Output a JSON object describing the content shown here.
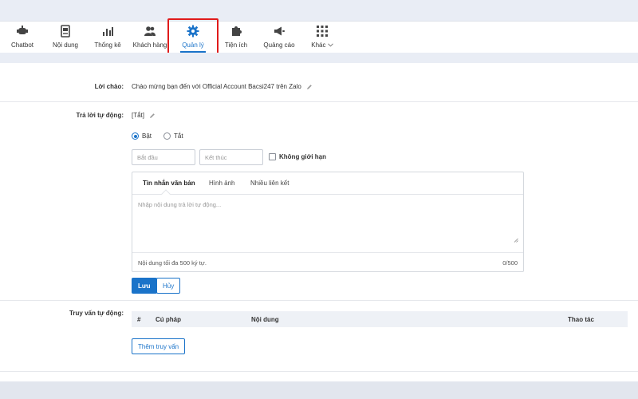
{
  "nav": {
    "items": [
      {
        "label": "Chatbot"
      },
      {
        "label": "Nội dung"
      },
      {
        "label": "Thống kê"
      },
      {
        "label": "Khách hàng"
      },
      {
        "label": "Quản lý"
      },
      {
        "label": "Tiện ích"
      },
      {
        "label": "Quảng cáo"
      },
      {
        "label": "Khác"
      }
    ],
    "active_index": 4
  },
  "greeting": {
    "label": "Lời chào:",
    "value": "Chào mừng bạn đến với Official Account Bacsi247 trên Zalo"
  },
  "auto_reply": {
    "label": "Trả lời tự động:",
    "status": "[Tắt]",
    "radio_on": "Bật",
    "radio_off": "Tắt",
    "selected": "Bật",
    "start_placeholder": "Bắt đầu",
    "end_placeholder": "Kết thúc",
    "unlimited_label": "Không giới hạn",
    "tabs": [
      "Tin nhắn văn bản",
      "Hình ảnh",
      "Nhiều liên kết"
    ],
    "active_tab": 0,
    "message_placeholder": "Nhập nội dung trả lời tự động...",
    "hint": "Nội dung tối đa 500 ký tự.",
    "counter": "0/500",
    "save_label": "Lưu",
    "cancel_label": "Hủy"
  },
  "query": {
    "label": "Truy vấn tự động:",
    "columns": [
      "#",
      "Cú pháp",
      "Nội dung",
      "Thao tác"
    ],
    "add_label": "Thêm truy vấn"
  },
  "colors": {
    "accent": "#1a73c9",
    "highlight": "#e01b1b"
  }
}
